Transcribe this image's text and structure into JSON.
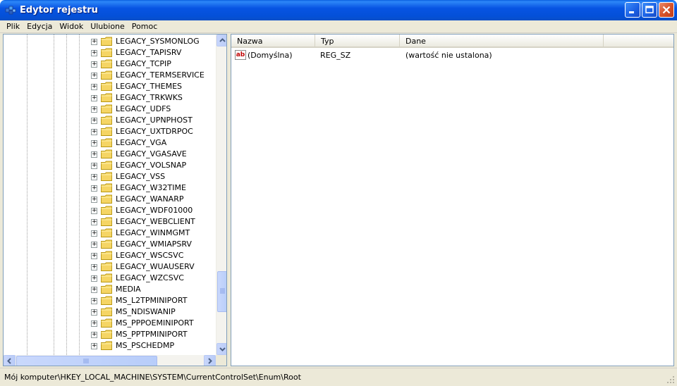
{
  "window": {
    "title": "Edytor rejestru"
  },
  "menu": [
    "Plik",
    "Edycja",
    "Widok",
    "Ulubione",
    "Pomoc"
  ],
  "tree": {
    "items": [
      "LEGACY_SYSMONLOG",
      "LEGACY_TAPISRV",
      "LEGACY_TCPIP",
      "LEGACY_TERMSERVICE",
      "LEGACY_THEMES",
      "LEGACY_TRKWKS",
      "LEGACY_UDFS",
      "LEGACY_UPNPHOST",
      "LEGACY_UXTDRPOC",
      "LEGACY_VGA",
      "LEGACY_VGASAVE",
      "LEGACY_VOLSNAP",
      "LEGACY_VSS",
      "LEGACY_W32TIME",
      "LEGACY_WANARP",
      "LEGACY_WDF01000",
      "LEGACY_WEBCLIENT",
      "LEGACY_WINMGMT",
      "LEGACY_WMIAPSRV",
      "LEGACY_WSCSVC",
      "LEGACY_WUAUSERV",
      "LEGACY_WZCSVC",
      "MEDIA",
      "MS_L2TPMINIPORT",
      "MS_NDISWANIP",
      "MS_PPPOEMINIPORT",
      "MS_PPTPMINIPORT",
      "MS_PSCHEDMP"
    ]
  },
  "list": {
    "columns": [
      "Nazwa",
      "Typ",
      "Dane"
    ],
    "rows": [
      {
        "name": "(Domyślna)",
        "type": "REG_SZ",
        "data": "(wartość nie ustalona)"
      }
    ]
  },
  "status": {
    "path": "Mój komputer\\HKEY_LOCAL_MACHINE\\SYSTEM\\CurrentControlSet\\Enum\\Root"
  },
  "colors": {
    "titlebar": "#0754e3",
    "chrome": "#ece9d8",
    "pane_border": "#7f9db9",
    "folder": "#f5d564"
  }
}
